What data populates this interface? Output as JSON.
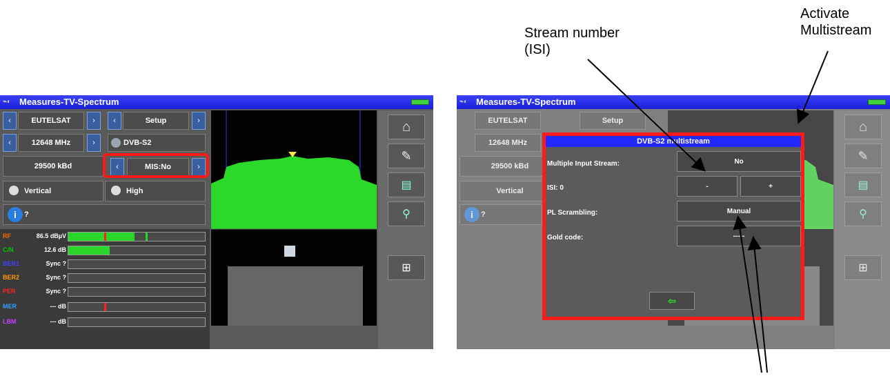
{
  "annotations": {
    "stream_number": "Stream number (ISI)",
    "activate_multistream": "Activate Multistream"
  },
  "left_screen": {
    "title": "Measures-TV-Spectrum",
    "satellite": "EUTELSAT",
    "setup": "Setup",
    "frequency": "12648 MHz",
    "standard": "DVB-S2",
    "symbol_rate": "29500 kBd",
    "multistream": "MIS:No",
    "polarization": "Vertical",
    "band": "High",
    "info": "?",
    "measures": [
      {
        "name": "RF",
        "value": "86.5 dBµV",
        "color": "#ff6a00"
      },
      {
        "name": "C/N",
        "value": "12.6 dB",
        "color": "#00c800"
      },
      {
        "name": "BER1",
        "value": "Sync ?",
        "color": "#4040ff"
      },
      {
        "name": "BER2",
        "value": "Sync ?",
        "color": "#ff9a00"
      },
      {
        "name": "PER",
        "value": "Sync ?",
        "color": "#ff2020"
      },
      {
        "name": "MER",
        "value": "--- dB",
        "color": "#30a0ff"
      },
      {
        "name": "LBM",
        "value": "--- dB",
        "color": "#c040ff"
      }
    ]
  },
  "right_screen": {
    "title": "Measures-TV-Spectrum",
    "satellite": "EUTELSAT",
    "setup": "Setup",
    "frequency": "12648 MHz",
    "symbol_rate": "29500 kBd",
    "polarization": "Vertical",
    "info": "?",
    "dialog": {
      "title": "DVB-S2 multistream",
      "mis_label": "Multiple Input Stream:",
      "mis_value": "No",
      "isi_label": "ISI: 0",
      "minus": "-",
      "plus": "+",
      "scrambling_label": "PL Scrambling:",
      "scrambling_value": "Manual",
      "gold_label": "Gold code:",
      "gold_value": "-----"
    }
  }
}
